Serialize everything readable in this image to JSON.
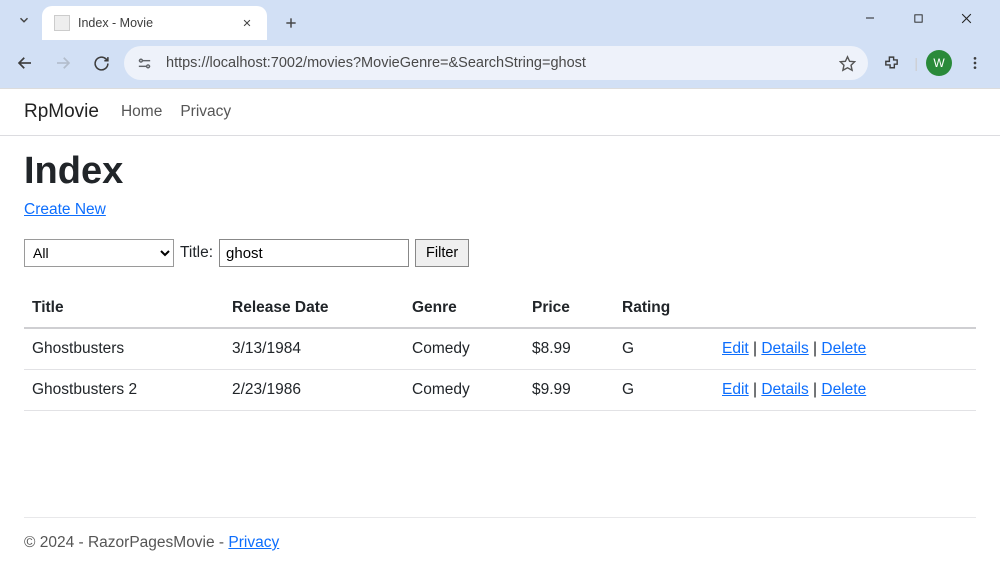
{
  "browser": {
    "tab_title": "Index - Movie",
    "url": "https://localhost:7002/movies?MovieGenre=&SearchString=ghost",
    "avatar_initial": "W"
  },
  "nav": {
    "brand": "RpMovie",
    "links": [
      "Home",
      "Privacy"
    ]
  },
  "page": {
    "heading": "Index",
    "create_link": "Create New",
    "filter": {
      "genre_selected": "All",
      "title_label": "Title:",
      "title_value": "ghost",
      "button": "Filter"
    },
    "table": {
      "columns": [
        "Title",
        "Release Date",
        "Genre",
        "Price",
        "Rating",
        ""
      ],
      "rows": [
        {
          "title": "Ghostbusters",
          "release_date": "3/13/1984",
          "genre": "Comedy",
          "price": "$8.99",
          "rating": "G"
        },
        {
          "title": "Ghostbusters 2",
          "release_date": "2/23/1986",
          "genre": "Comedy",
          "price": "$9.99",
          "rating": "G"
        }
      ],
      "actions": {
        "edit": "Edit",
        "details": "Details",
        "delete": "Delete"
      }
    }
  },
  "footer": {
    "text": "© 2024 - RazorPagesMovie - ",
    "privacy": "Privacy"
  }
}
